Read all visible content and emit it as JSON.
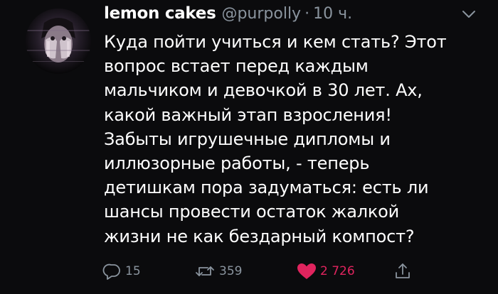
{
  "tweet": {
    "author_name": "lemon cakes",
    "author_handle": "@purpolly",
    "separator": "·",
    "timestamp": "10 ч.",
    "text_lines": [
      "Куда пойти учиться и кем стать? Этот",
      "вопрос встает перед каждым",
      "мальчиком и девочкой в 30 лет. Ах,",
      "какой важный этап взросления!",
      "Забыты игрушечные дипломы и",
      "иллюзорные работы, - теперь",
      "детишкам пора задуматься: есть ли",
      "шансы провести остаток жалкой",
      "жизни не как бездарный компост?"
    ]
  },
  "actions": {
    "reply": {
      "icon": "reply-icon",
      "count": "15"
    },
    "retweet": {
      "icon": "retweet-icon",
      "count": "359"
    },
    "like": {
      "icon": "heart-icon",
      "count": "2 726",
      "active": true
    },
    "share": {
      "icon": "share-icon"
    }
  },
  "colors": {
    "background": "#0b0b0d",
    "text": "#ffffff",
    "muted": "#8a949e",
    "like": "#e0245e"
  }
}
